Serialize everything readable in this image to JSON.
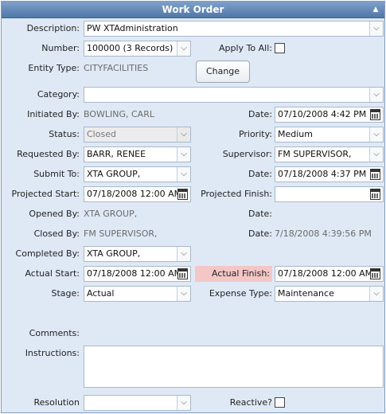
{
  "title": "Work Order",
  "labels": {
    "description": "Description:",
    "number": "Number:",
    "apply_to_all": "Apply To All:",
    "entity_type": "Entity Type:",
    "category": "Category:",
    "initiated_by": "Initiated By:",
    "date": "Date:",
    "status": "Status:",
    "priority": "Priority:",
    "requested_by": "Requested By:",
    "supervisor": "Supervisor:",
    "submit_to": "Submit To:",
    "projected_start": "Projected Start:",
    "projected_finish": "Projected Finish:",
    "opened_by": "Opened By:",
    "closed_by": "Closed By:",
    "completed_by": "Completed By:",
    "actual_start": "Actual Start:",
    "actual_finish": "Actual Finish:",
    "stage": "Stage:",
    "expense_type": "Expense Type:",
    "comments": "Comments:",
    "instructions": "Instructions:",
    "resolution": "Resolution",
    "reactive": "Reactive?"
  },
  "values": {
    "description": "PW XTAdministration",
    "number": "100000 (3 Records)",
    "entity_type": "CITYFACILITIES",
    "category": "",
    "initiated_by": "BOWLING, CARL",
    "initiated_date": "07/10/2008 4:42 PM",
    "status": "Closed",
    "priority": "Medium",
    "requested_by": "BARR, RENEE",
    "supervisor": "FM SUPERVISOR,",
    "submit_to": "XTA GROUP,",
    "submit_date": "07/18/2008 4:37 PM",
    "projected_start": "07/18/2008 12:00 AM",
    "projected_finish": "",
    "opened_by": "XTA GROUP,",
    "opened_date": "",
    "closed_by": "FM SUPERVISOR,",
    "closed_date": "7/18/2008 4:39:56 PM",
    "completed_by": "XTA GROUP,",
    "actual_start": "07/18/2008 12:00 AM",
    "actual_finish": "07/18/2008 12:00 AM",
    "stage": "Actual",
    "expense_type": "Maintenance",
    "comments": "",
    "instructions": "",
    "resolution": ""
  },
  "buttons": {
    "change": "Change"
  },
  "checkboxes": {
    "apply_to_all": false,
    "reactive": false
  },
  "icons": {
    "collapse": "chevron-up-icon",
    "calendar": "calendar-icon",
    "dropdown": "chevron-down-icon"
  },
  "colors": {
    "title_bar": "#5a80b2",
    "panel_bg": "#dfe9f6",
    "highlight": "#f4c7c7"
  }
}
